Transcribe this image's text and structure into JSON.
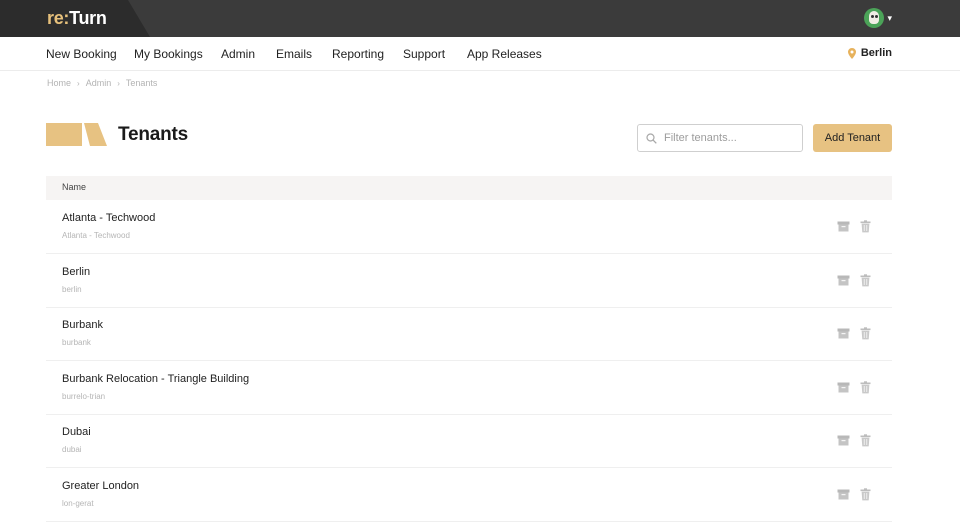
{
  "app": {
    "logo_re": "re:",
    "logo_turn": "Turn"
  },
  "nav": {
    "items": [
      "New Booking",
      "My Bookings",
      "Admin",
      "Emails",
      "Reporting",
      "Support",
      "App Releases"
    ],
    "location": "Berlin"
  },
  "breadcrumb": [
    "Home",
    "Admin",
    "Tenants"
  ],
  "page": {
    "title": "Tenants",
    "filter_placeholder": "Filter tenants...",
    "add_button": "Add Tenant"
  },
  "table": {
    "columns": [
      "Name"
    ],
    "rows": [
      {
        "name": "Atlanta - Techwood",
        "slug": "Atlanta - Techwood"
      },
      {
        "name": "Berlin",
        "slug": "berlin"
      },
      {
        "name": "Burbank",
        "slug": "burbank"
      },
      {
        "name": "Burbank Relocation - Triangle Building",
        "slug": "burrelo-trian"
      },
      {
        "name": "Dubai",
        "slug": "dubai"
      },
      {
        "name": "Greater London",
        "slug": "lon-gerat"
      }
    ]
  },
  "colors": {
    "accent": "#e7c282",
    "topbar": "#3b3b3b",
    "avatar": "#4ba358"
  },
  "icons": {
    "search": "search-icon",
    "pin": "map-pin-icon",
    "archive": "archive-icon",
    "trash": "trash-icon",
    "caret": "chevron-down-icon"
  }
}
